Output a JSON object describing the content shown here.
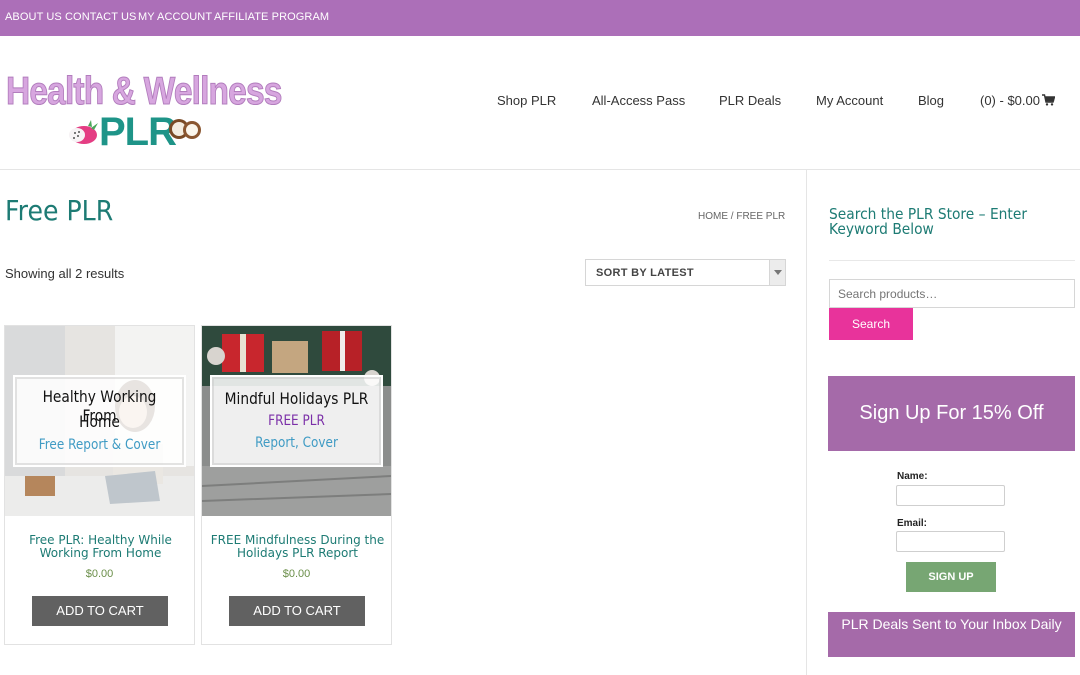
{
  "topbar": {
    "links": [
      "ABOUT US",
      "CONTACT US",
      "MY ACCOUNT",
      "AFFILIATE PROGRAM"
    ]
  },
  "header": {
    "logo_line1": "Health & Wellness",
    "logo_line2": "PLR",
    "nav": [
      "Shop PLR",
      "All-Access Pass",
      "PLR Deals",
      "My Account",
      "Blog"
    ],
    "cart": "(0) - $0.00"
  },
  "main": {
    "title": "Free PLR",
    "breadcrumb_home": "HOME",
    "breadcrumb_sep": " / ",
    "breadcrumb_current": "FREE PLR",
    "results_text": "Showing all 2 results",
    "sort_selected": "SORT BY LATEST",
    "products": [
      {
        "thumb_title_1": "Healthy Working From",
        "thumb_title_2": "Home",
        "thumb_sub": "Free Report & Cover",
        "name": "Free PLR: Healthy While Working From Home",
        "price": "$0.00",
        "button": "ADD TO CART"
      },
      {
        "thumb_title_1": "Mindful Holidays PLR",
        "thumb_title_2": "FREE PLR",
        "thumb_sub": "Report, Cover",
        "name": "FREE Mindfulness During the Holidays PLR Report",
        "price": "$0.00",
        "button": "ADD TO CART"
      }
    ]
  },
  "sidebar": {
    "search_title": "Search the PLR Store – Enter Keyword Below",
    "search_placeholder": "Search products…",
    "search_button": "Search",
    "signup_heading": "Sign Up For 15% Off",
    "name_label": "Name:",
    "email_label": "Email:",
    "signup_button": "SIGN UP",
    "deals_text": "PLR Deals Sent to Your Inbox Daily"
  },
  "colors": {
    "topbar": "#ac6fb8",
    "accent_teal": "#1d7b74",
    "search_pink": "#e8339b",
    "signup_purple": "#a56aa9",
    "signup_green": "#77a673"
  }
}
